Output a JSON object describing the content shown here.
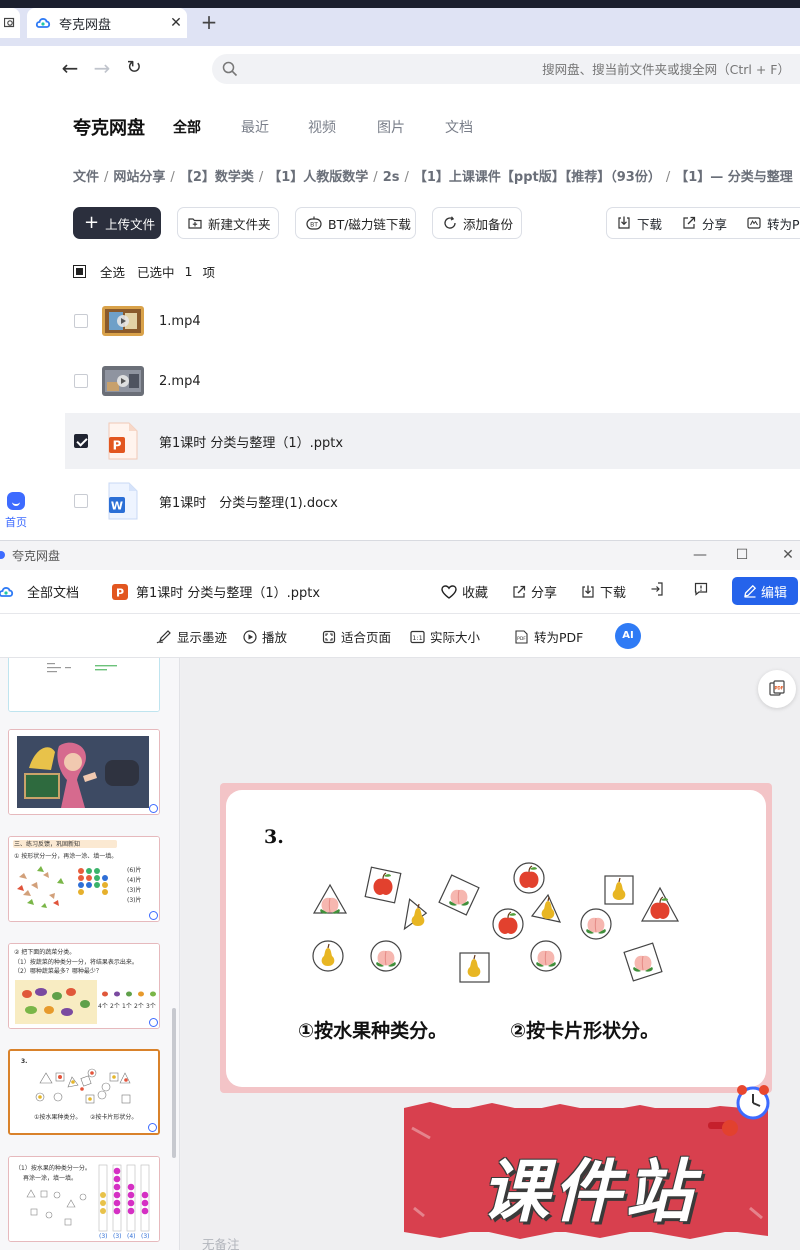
{
  "browser": {
    "tab_prev_icon": "search-tab-icon",
    "tab_title": "夸克网盘",
    "address_placeholder": "搜网盘、搜当前文件夹或搜全网（Ctrl + F）"
  },
  "rail": {
    "home_label": "首页"
  },
  "drive": {
    "brand": "夸克网盘",
    "categories": [
      "全部",
      "最近",
      "视频",
      "图片",
      "文档"
    ],
    "breadcrumbs": [
      "文件",
      "网站分享",
      "【2】数学类",
      "【1】人教版数学",
      "2s",
      "【1】上课课件【ppt版】【推荐】（93份）",
      "【1】— 分类与整理"
    ],
    "toolbar": {
      "upload": "上传文件",
      "new_folder": "新建文件夹",
      "bt": "BT/磁力链下载",
      "backup": "添加备份",
      "download": "下载",
      "share": "分享",
      "convert_pdf": "转为PDF"
    },
    "select_all": "全选",
    "selected_text": "已选中",
    "selected_count": "1",
    "selected_unit": "项",
    "files": [
      {
        "name": "1.mp4",
        "type": "video",
        "checked": false
      },
      {
        "name": "2.mp4",
        "type": "video",
        "checked": false
      },
      {
        "name": "第1课时 分类与整理（1）.pptx",
        "type": "pptx",
        "checked": true
      },
      {
        "name": "第1课时　分类与整理(1).docx",
        "type": "docx",
        "checked": false
      }
    ]
  },
  "viewer": {
    "window_title": "夸克网盘",
    "all_docs": "全部文档",
    "doc_title": "第1课时 分类与整理（1）.pptx",
    "favorite": "收藏",
    "share": "分享",
    "download": "下载",
    "edit": "编辑",
    "tools": {
      "ink": "显示墨迹",
      "play": "播放",
      "fit": "适合页面",
      "actual": "实际大小",
      "to_pdf": "转为PDF",
      "ai": "AI"
    },
    "notes_placeholder": "无备注",
    "slide": {
      "number": "3.",
      "task1": "①按水果种类分。",
      "task2": "②按卡片形状分。"
    },
    "thumbs": {
      "t3_heading": "三、练习反馈，巩固新知",
      "t3_task": "① 按形状分一分，再涂一涂、填一填。",
      "t3_counts": [
        "(6)片",
        "(4)片",
        "(3)片",
        "(3)片"
      ],
      "t4_task": "② 把下面的蔬菜分类。",
      "t4_sub1": "（1）按蔬菜的种类分一分，将结果表示出来。",
      "t4_sub2": "（2）哪种蔬菜最多？哪种最少？",
      "t4_counts": [
        "4个",
        "2个",
        "1个",
        "2个",
        "3个"
      ],
      "t5_num": "3.",
      "t5_task1": "①按水果种类分。",
      "t5_task2": "②按卡片形状分。",
      "t6_task": "（1）按水果的种类分一分。",
      "t6_sub": "再涂一涂，填一填。",
      "t6_counts": [
        "(3)",
        "(3)",
        "(4)",
        "(3)"
      ]
    },
    "watermark": "课件站"
  },
  "colors": {
    "accent": "#2563eb",
    "dark_button": "#2b2f3d",
    "slide_frame": "#f3c4c7",
    "watermark_red": "#d8404e",
    "ppt_orange": "#e2561f",
    "word_blue": "#2b6fd6"
  }
}
